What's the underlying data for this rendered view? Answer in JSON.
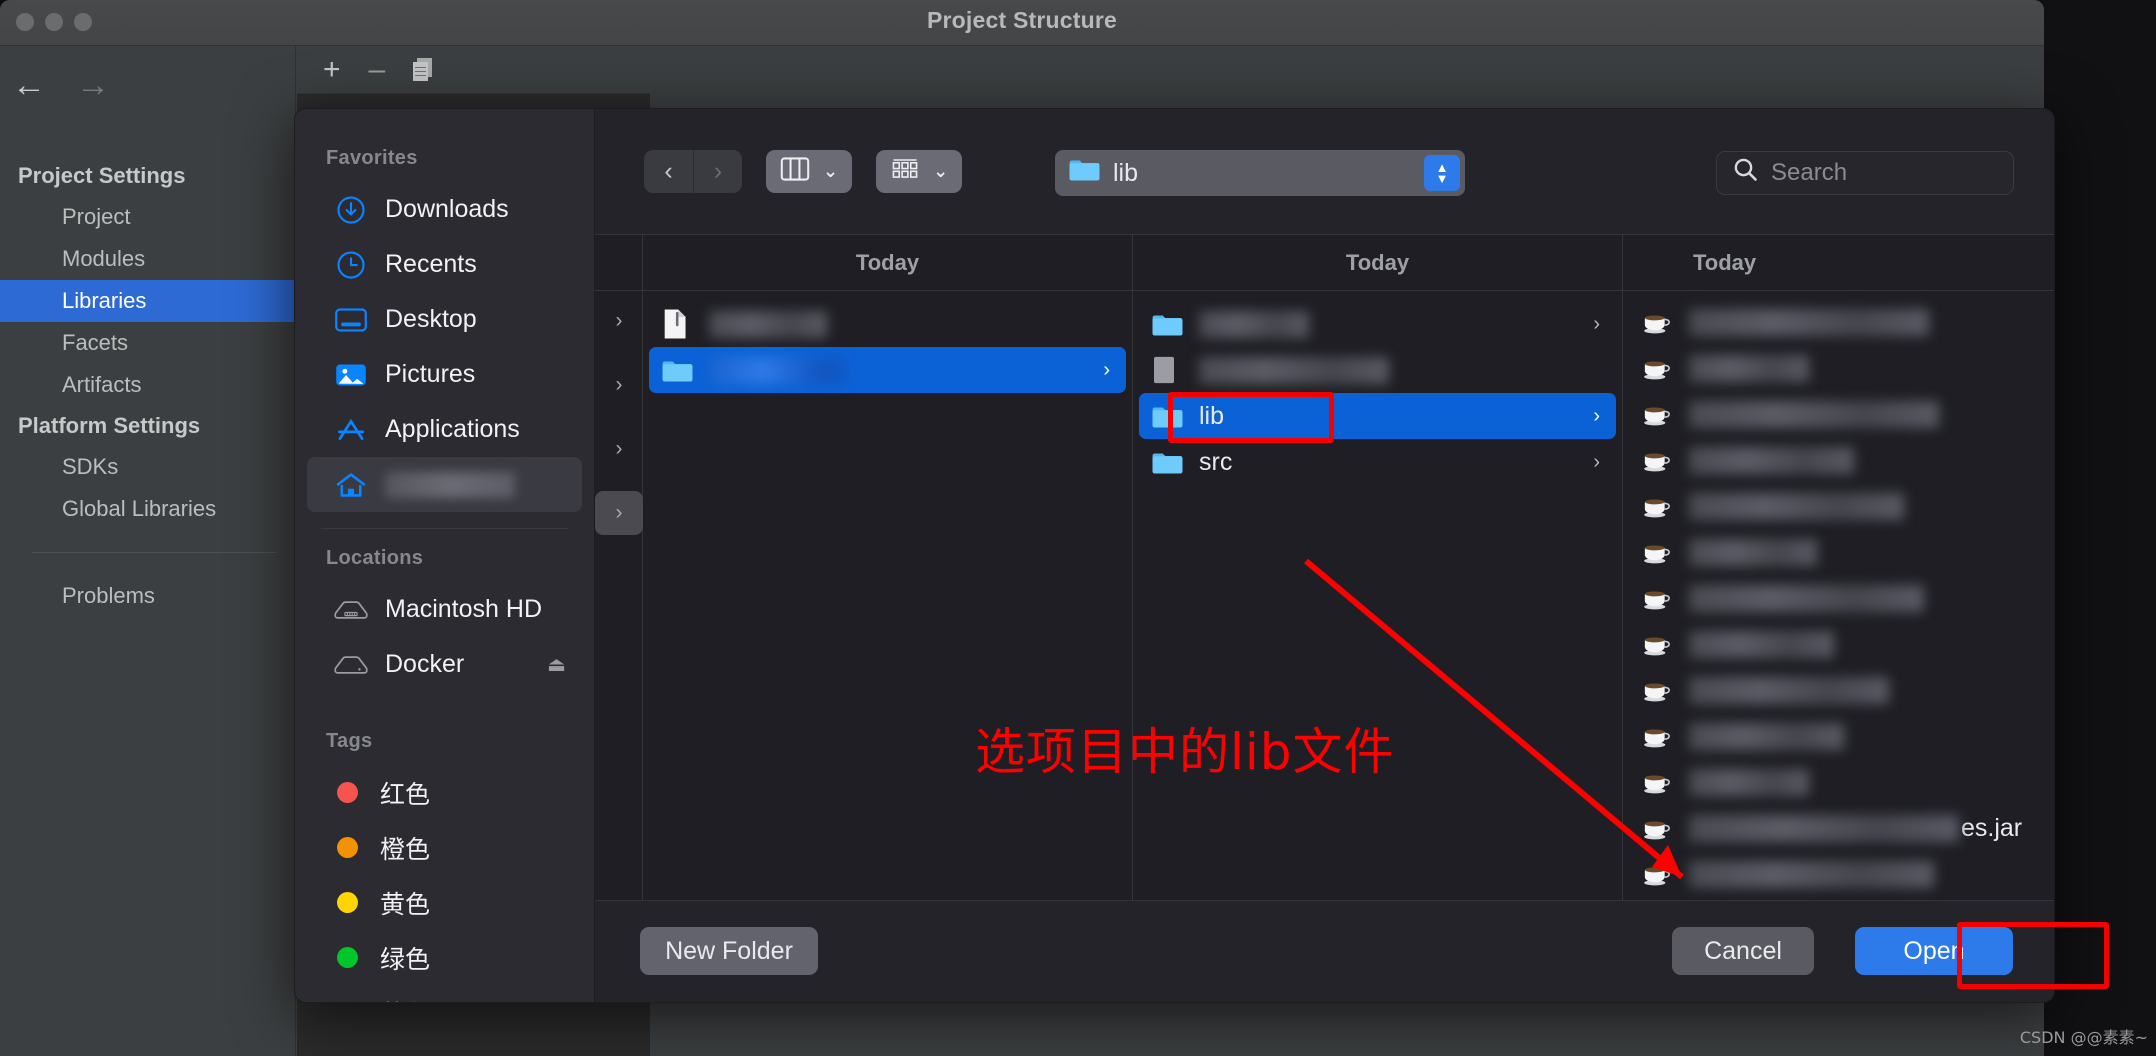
{
  "ide": {
    "title": "Project Structure",
    "toolbar": {
      "add": "+",
      "remove": "–",
      "copy_icon": "copy-icon"
    },
    "nav": {
      "back_icon": "arrow-left-icon",
      "forward_icon": "arrow-right-icon",
      "groups": [
        {
          "label": "Project Settings",
          "items": [
            "Project",
            "Modules",
            "Libraries",
            "Facets",
            "Artifacts"
          ]
        },
        {
          "label": "Platform Settings",
          "items": [
            "SDKs",
            "Global Libraries"
          ]
        }
      ],
      "footer_items": [
        "Problems"
      ],
      "selected": "Libraries"
    }
  },
  "dialog": {
    "sidebar": {
      "sections": [
        {
          "title": "Favorites",
          "items": [
            {
              "label": "Downloads",
              "icon": "download-circle-icon",
              "redacted": false
            },
            {
              "label": "Recents",
              "icon": "clock-icon",
              "redacted": false
            },
            {
              "label": "Desktop",
              "icon": "desktop-icon",
              "redacted": false
            },
            {
              "label": "Pictures",
              "icon": "pictures-icon",
              "redacted": false
            },
            {
              "label": "Applications",
              "icon": "applications-icon",
              "redacted": false
            },
            {
              "label": "",
              "icon": "home-icon",
              "redacted": true,
              "selected": true
            }
          ]
        },
        {
          "title": "Locations",
          "items": [
            {
              "label": "Macintosh HD",
              "icon": "harddisk-icon",
              "redacted": false
            },
            {
              "label": "Docker",
              "icon": "disk-icon",
              "redacted": false,
              "eject": "⏏"
            }
          ]
        },
        {
          "title": "Tags",
          "items": [
            {
              "label": "红色",
              "icon": "tag-dot-red",
              "color": "#f8544f"
            },
            {
              "label": "橙色",
              "icon": "tag-dot-orange",
              "color": "#f39200"
            },
            {
              "label": "黄色",
              "icon": "tag-dot-yellow",
              "color": "#ffd400"
            },
            {
              "label": "绿色",
              "icon": "tag-dot-green",
              "color": "#00c62c"
            },
            {
              "label": "蓝色",
              "icon": "tag-dot-blue",
              "color": "#0a93f5"
            }
          ]
        }
      ]
    },
    "toolbar": {
      "back_icon": "chevron-left-icon",
      "forward_icon": "chevron-right-icon",
      "view_column_icon": "column-view-icon",
      "view_column_chevron": "chevron-down-icon",
      "group_icon": "group-view-icon",
      "group_chevron": "chevron-down-icon",
      "path_folder_icon": "folder-icon",
      "path_value": "lib",
      "path_stepper_icon": "stepper-updown-icon",
      "search_icon": "search-icon",
      "search_placeholder": "Search",
      "search_value": ""
    },
    "columns": [
      {
        "header": "",
        "kind": "disclosure",
        "rows": [
          {
            "chevron": "›",
            "highlighted": false
          },
          {
            "chevron": "›",
            "highlighted": false
          },
          {
            "chevron": "›",
            "highlighted": false
          },
          {
            "chevron": "›",
            "highlighted": true
          }
        ]
      },
      {
        "header": "Today",
        "rows": [
          {
            "name": "",
            "redacted": true,
            "redacted_width": 118,
            "icon": "document-icon",
            "selected": false,
            "has_children": false
          },
          {
            "name": "",
            "redacted": true,
            "redacted_width": 136,
            "icon": "folder-icon",
            "selected": true,
            "has_children": true,
            "chevron": "›"
          }
        ]
      },
      {
        "header": "Today",
        "rows": [
          {
            "name": "",
            "redacted": true,
            "redacted_width": 110,
            "icon": "folder-icon",
            "selected": false,
            "has_children": true,
            "chevron": "›"
          },
          {
            "name": "",
            "redacted": true,
            "redacted_width": 190,
            "icon": "file-generic-icon",
            "selected": false,
            "has_children": false
          },
          {
            "name": "lib",
            "redacted": false,
            "icon": "folder-icon",
            "selected": true,
            "has_children": true,
            "chevron": "›",
            "annotated": true
          },
          {
            "name": "src",
            "redacted": false,
            "icon": "folder-icon",
            "selected": false,
            "has_children": true,
            "chevron": "›"
          }
        ]
      },
      {
        "header": "Today",
        "rows": [
          {
            "name": "",
            "redacted": true,
            "redacted_width": 240,
            "icon": "jar-icon"
          },
          {
            "name": "",
            "redacted": true,
            "redacted_width": 120,
            "icon": "jar-icon"
          },
          {
            "name": "",
            "redacted": true,
            "redacted_width": 250,
            "icon": "jar-icon"
          },
          {
            "name": "",
            "redacted": true,
            "redacted_width": 165,
            "icon": "jar-icon"
          },
          {
            "name": "",
            "redacted": true,
            "redacted_width": 215,
            "icon": "jar-icon"
          },
          {
            "name": "",
            "redacted": true,
            "redacted_width": 128,
            "icon": "jar-icon"
          },
          {
            "name": "",
            "redacted": true,
            "redacted_width": 235,
            "icon": "jar-icon"
          },
          {
            "name": "",
            "redacted": true,
            "redacted_width": 145,
            "icon": "jar-icon"
          },
          {
            "name": "",
            "redacted": true,
            "redacted_width": 200,
            "icon": "jar-icon"
          },
          {
            "name": "",
            "redacted": true,
            "redacted_width": 155,
            "icon": "jar-icon"
          },
          {
            "name": "",
            "redacted": true,
            "redacted_width": 120,
            "icon": "jar-icon"
          },
          {
            "name": "es.jar",
            "redacted": true,
            "redacted_width": 270,
            "icon": "jar-icon"
          },
          {
            "name": "",
            "redacted": true,
            "redacted_width": 245,
            "icon": "jar-icon"
          }
        ]
      }
    ],
    "buttons": {
      "new_folder": "New Folder",
      "cancel": "Cancel",
      "open": "Open"
    }
  },
  "annotations": {
    "callout_text": "选项目中的lib文件",
    "callout_color": "#ff0000",
    "highlight_lib": "lib-highlight-box",
    "highlight_open": "open-button-highlight-box",
    "arrow": "red-arrow"
  },
  "watermark": "CSDN @@素素~"
}
